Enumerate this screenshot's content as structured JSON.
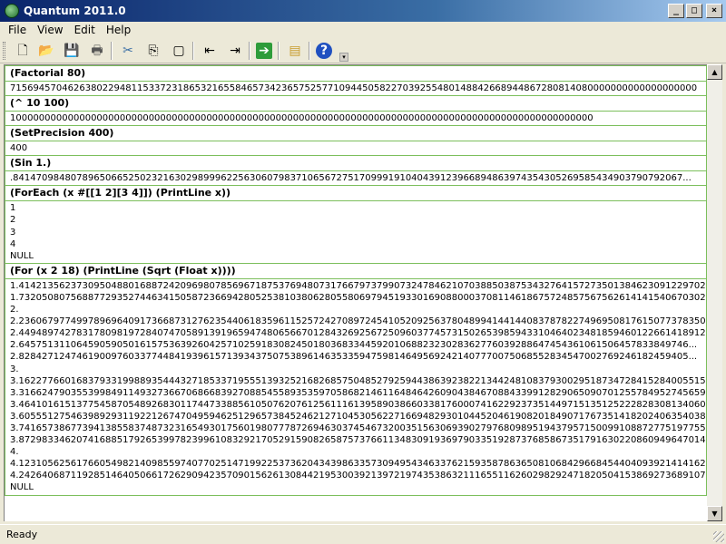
{
  "window": {
    "title": "Quantum 2011.0"
  },
  "menu": [
    "File",
    "View",
    "Edit",
    "Help"
  ],
  "toolbar": [
    {
      "name": "new-file-icon",
      "glyph": "🗋"
    },
    {
      "name": "open-folder-icon",
      "glyph": "📂"
    },
    {
      "name": "save-icon",
      "glyph": "💾"
    },
    {
      "name": "print-icon",
      "glyph": "🖶"
    },
    {
      "name": "cut-icon",
      "glyph": "✂"
    },
    {
      "name": "copy-icon",
      "glyph": "⎘"
    },
    {
      "name": "paste-icon",
      "glyph": "▢"
    },
    {
      "name": "indent-icon",
      "glyph": "⇤"
    },
    {
      "name": "outdent-icon",
      "glyph": "⇥"
    },
    {
      "name": "run-icon",
      "glyph": "➔"
    },
    {
      "name": "new-window-icon",
      "glyph": "▤"
    },
    {
      "name": "help-icon",
      "glyph": "?"
    }
  ],
  "blocks": [
    {
      "cmd": "(Factorial 80)",
      "output": "71569457046263802294811533723186532165584657342365752577109445058227039255480148842668944867280814080000000000000000000"
    },
    {
      "cmd": "(^ 10 100)",
      "output": "10000000000000000000000000000000000000000000000000000000000000000000000000000000000000000000000000000"
    },
    {
      "cmd": "(SetPrecision 400)",
      "output": "400"
    },
    {
      "cmd": "(Sin 1.)",
      "output": ".84147098480789650665250232163029899962256306079837106567275170999191040439123966894863974354305269585434903790792067..."
    },
    {
      "cmd": "(ForEach (x #[[1 2][3 4]]) (PrintLine x))",
      "output": "1\n2\n3\n4\nNULL"
    },
    {
      "cmd": "(For (x 2 18) (PrintLine (Sqrt (Float x))))",
      "output": "1.41421356237309504880168872420969807856967187537694807317667973799073247846210703885038753432764157273501384623091229702...\n1.73205080756887729352744634150587236694280525381038062805580697945193301690880003708114618675724857567562614141540670302...\n2.\n2.23606797749978969640917366873127623544061835961152572427089724541052092563780489941441440837878227496950817615077378350...\n2.44948974278317809819728407470589139196594748065667012843269256725096037745731502653985943310464023481859460122661418912...\n2.64575131106459059050161575363926042571025918308245018036833445920106882323028362776039288647454361061506457833849746...\n2.82842712474619009760337744841939615713934375075389614635335947598146495692421407770075068552834547002769246182459405...\n3.\n3.16227766016837933199889354443271853371955513932521682685750485279259443863923822134424810837930029518734728415284005515...\n3.31662479035539984911493273667068668392708854558935359705868214611648464260904384670884339912829065090701255784952745659...\n3.46410161513775458705489268301174473388561050762076125611161395890386603381760007416229237351449715135125222828308134060...\n3.60555127546398929311922126747049594625129657384524621271045305622716694829301044520461908201849071767351418202406354038...\n3.74165738677394138558374873231654930175601980777872694630374546732003515630693902797680989519437957150099108872775197755...\n3.87298334620741688517926539978239961083292170529159082658757376611348309193697903351928737685867351791630220860949647014...\n4.\n4.12310562561766054982140985597407702514719922537362043439863357309495434633762159358786365081068429668454404093921414162...\n4.24264068711928514640506617262909423570901562613084421953003921397219743538632111655116260298292471820504153869273689107...\nNULL"
    }
  ],
  "status": {
    "text": "Ready"
  }
}
